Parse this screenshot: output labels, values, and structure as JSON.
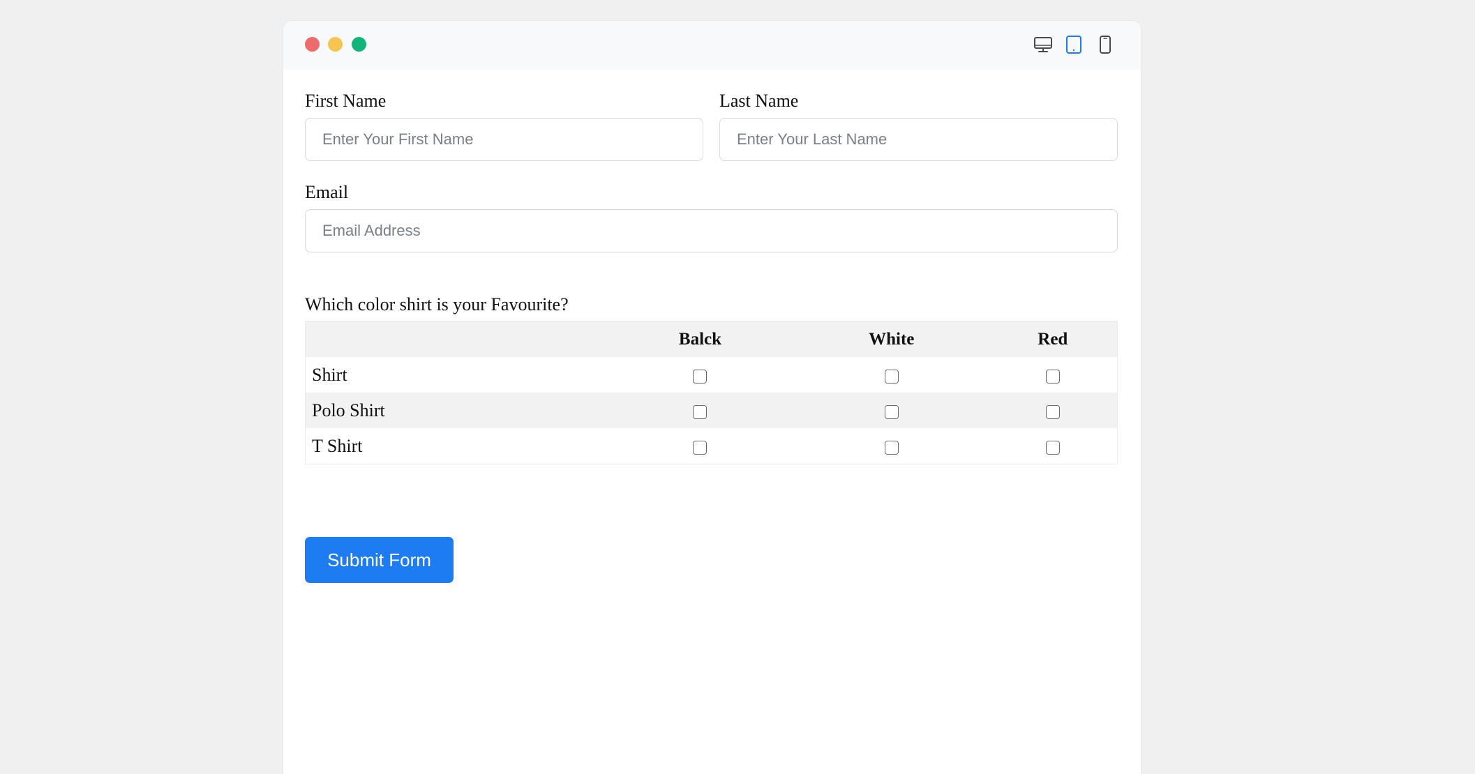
{
  "window": {
    "controls": [
      {
        "name": "close",
        "color": "#ec6b6d"
      },
      {
        "name": "minimize",
        "color": "#f6c451"
      },
      {
        "name": "maximize",
        "color": "#13b479"
      }
    ],
    "device_icons": [
      {
        "name": "desktop-icon",
        "active": false
      },
      {
        "name": "tablet-icon",
        "active": true
      },
      {
        "name": "mobile-icon",
        "active": false
      }
    ],
    "active_color": "#1d7cf2",
    "inactive_color": "#4a4a4a"
  },
  "form": {
    "first_name": {
      "label": "First Name",
      "placeholder": "Enter Your First Name",
      "value": ""
    },
    "last_name": {
      "label": "Last Name",
      "placeholder": "Enter Your Last Name",
      "value": ""
    },
    "email": {
      "label": "Email",
      "placeholder": "Email Address",
      "value": ""
    },
    "question": "Which color shirt is your Favourite?",
    "matrix": {
      "columns": [
        "Balck",
        "White",
        "Red"
      ],
      "rows": [
        {
          "label": "Shirt",
          "checked": [
            false,
            false,
            false
          ]
        },
        {
          "label": "Polo Shirt",
          "checked": [
            false,
            false,
            false
          ]
        },
        {
          "label": "T Shirt",
          "checked": [
            false,
            false,
            false
          ]
        }
      ]
    },
    "submit_label": "Submit Form",
    "submit_color": "#1d7cf2"
  }
}
